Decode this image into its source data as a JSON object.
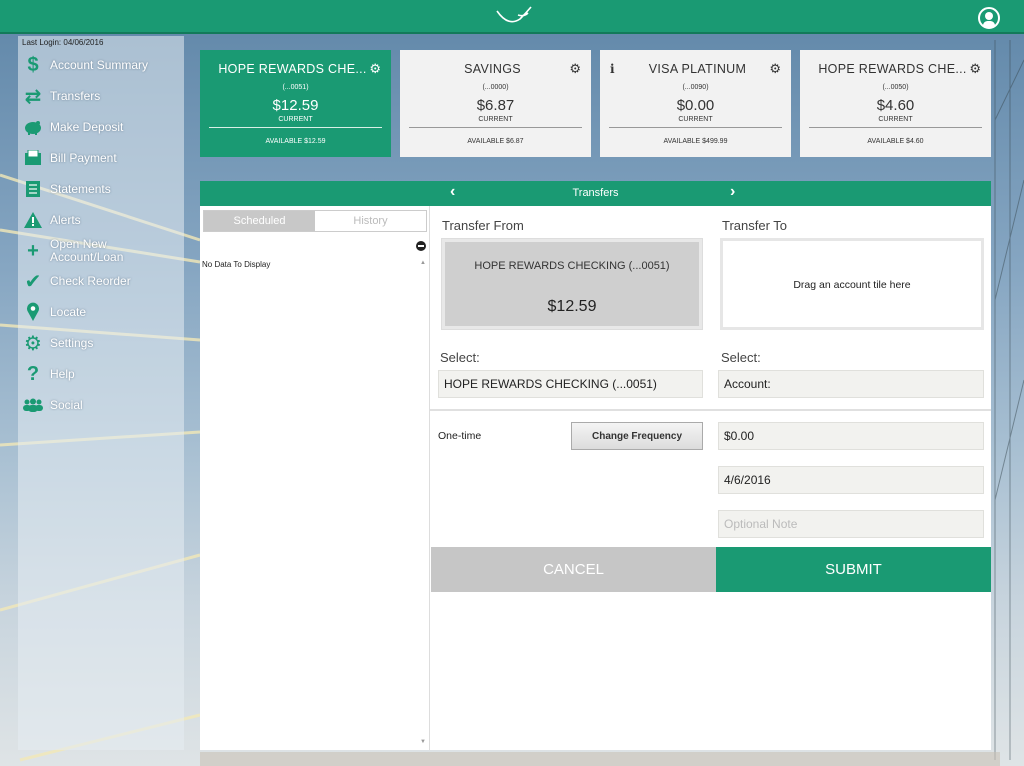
{
  "colors": {
    "brand": "#1a9a73",
    "tile_bg": "#f2f2f2",
    "cancel": "#c6c6c6"
  },
  "header": {
    "logo_icon": "bird-logo-icon",
    "profile_icon": "user-profile-icon"
  },
  "sidebar": {
    "last_login": "Last Login: 04/06/2016",
    "items": [
      {
        "label": "Account Summary",
        "icon": "dollar-icon"
      },
      {
        "label": "Transfers",
        "icon": "transfer-arrows-icon"
      },
      {
        "label": "Make Deposit",
        "icon": "piggy-bank-icon"
      },
      {
        "label": "Bill Payment",
        "icon": "bill-envelope-icon"
      },
      {
        "label": "Statements",
        "icon": "document-icon"
      },
      {
        "label": "Alerts",
        "icon": "warning-icon"
      },
      {
        "label": "Open New Account/Loan",
        "icon": "plus-icon"
      },
      {
        "label": "Check Reorder",
        "icon": "checkmark-icon"
      },
      {
        "label": "Locate",
        "icon": "map-pin-icon"
      },
      {
        "label": "Settings",
        "icon": "gear-icon"
      },
      {
        "label": "Help",
        "icon": "question-icon"
      },
      {
        "label": "Social",
        "icon": "people-icon"
      }
    ]
  },
  "accounts": [
    {
      "name": "HOPE REWARDS CHE...",
      "number": "(...0051)",
      "balance": "$12.59",
      "current_label": "CURRENT",
      "available": "AVAILABLE $12.59",
      "active": true
    },
    {
      "name": "SAVINGS",
      "number": "(...0000)",
      "balance": "$6.87",
      "current_label": "CURRENT",
      "available": "AVAILABLE $6.87",
      "active": false
    },
    {
      "name": "VISA PLATINUM",
      "number": "(...0090)",
      "balance": "$0.00",
      "current_label": "CURRENT",
      "available": "AVAILABLE $499.99",
      "active": false,
      "info": "i"
    },
    {
      "name": "HOPE REWARDS CHE...",
      "number": "(...0050)",
      "balance": "$4.60",
      "current_label": "CURRENT",
      "available": "AVAILABLE $4.60",
      "active": false
    }
  ],
  "transfers": {
    "title": "Transfers",
    "tabs": {
      "scheduled": "Scheduled",
      "history": "History"
    },
    "no_data": "No Data To Display",
    "from_label": "Transfer From",
    "to_label": "Transfer To",
    "from_account": {
      "name": "HOPE REWARDS CHECKING (...0051)",
      "balance": "$12.59"
    },
    "to_hint": "Drag an account tile here",
    "select_from_label": "Select:",
    "select_from_value": "HOPE REWARDS CHECKING (...0051)",
    "select_to_label": "Select:",
    "select_to_value": "Account:",
    "frequency": "One-time",
    "change_frequency": "Change Frequency",
    "amount": "$0.00",
    "date": "4/6/2016",
    "note_placeholder": "Optional Note",
    "cancel": "CANCEL",
    "submit": "SUBMIT"
  }
}
